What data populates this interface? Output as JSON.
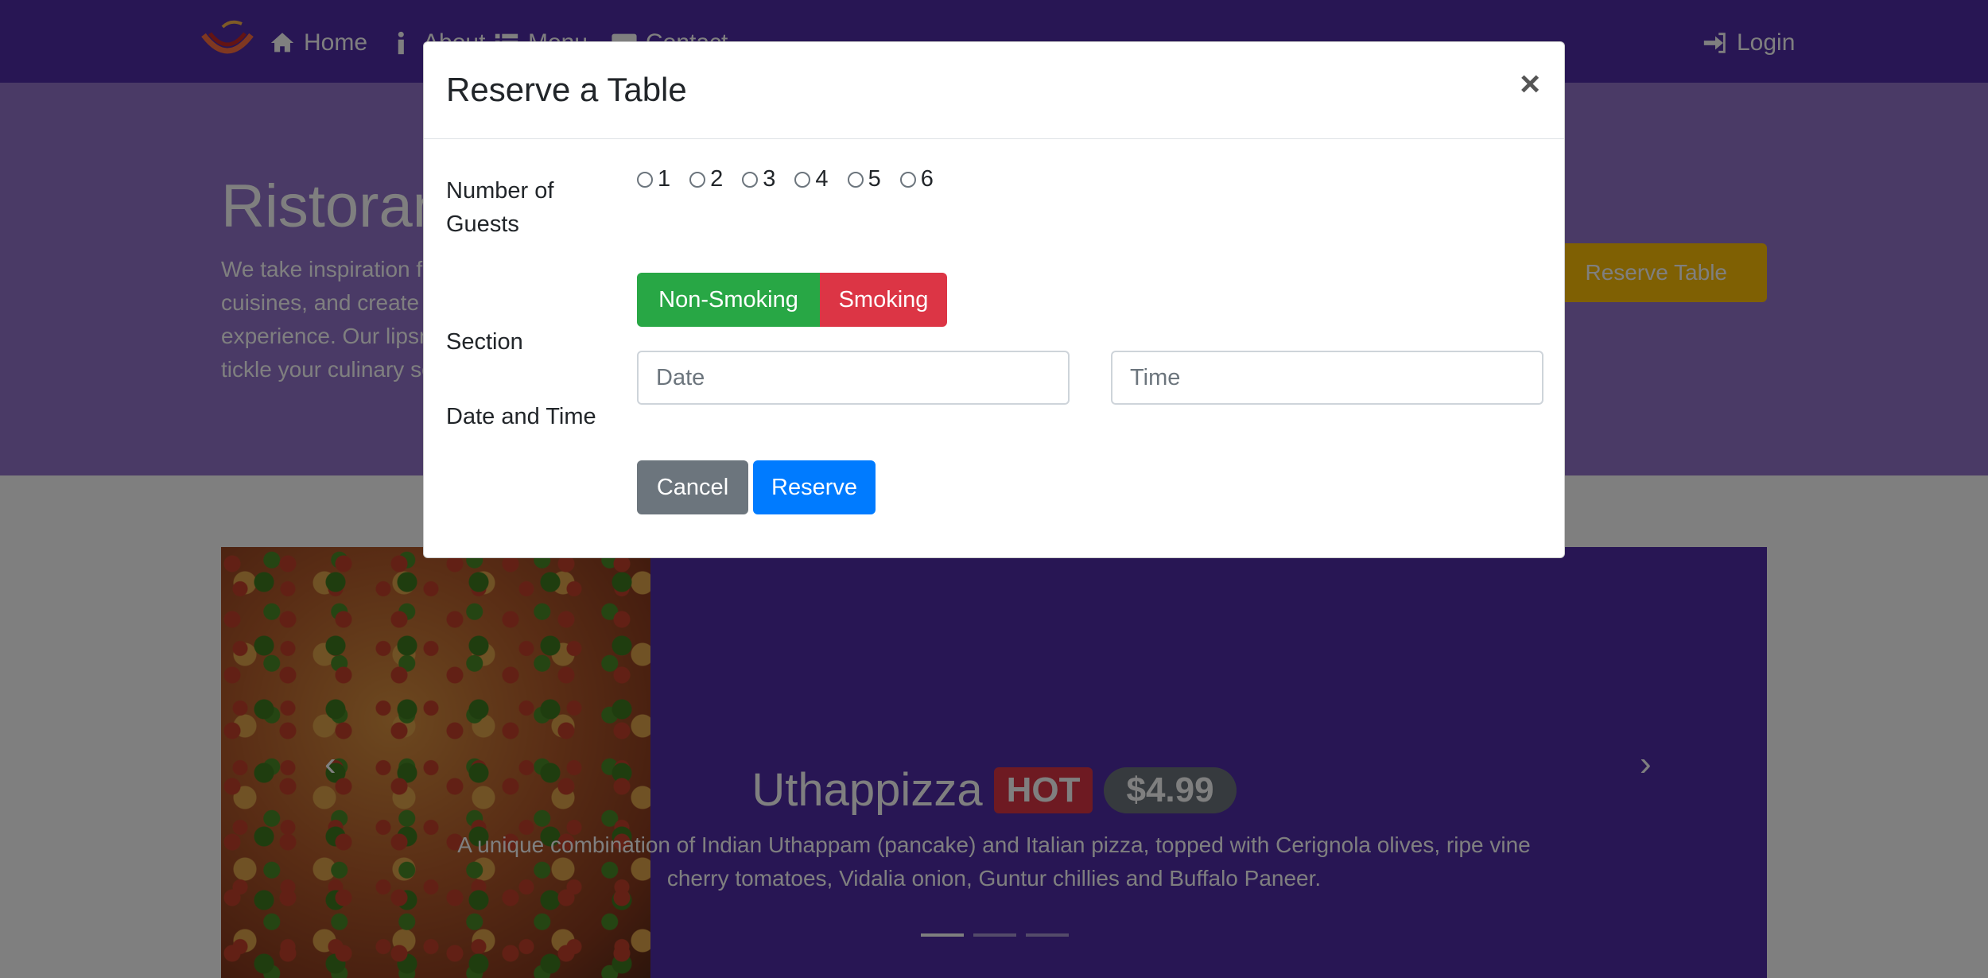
{
  "navbar": {
    "home": "Home",
    "about": "About",
    "menu": "Menu",
    "contact": "Contact",
    "login": "Login"
  },
  "jumbotron": {
    "title": "Ristorante Con Fusion",
    "text": "We take inspiration from the World's best cuisines, and create a unique fusion experience. Our lipsmacking creations will tickle your culinary senses!",
    "reserve_button": "Reserve Table"
  },
  "carousel": {
    "dish_name": "Uthappizza",
    "badge": "HOT",
    "price": "$4.99",
    "description": "A unique combination of Indian Uthappam (pancake) and Italian pizza, topped with Cerignola olives, ripe vine cherry tomatoes, Vidalia onion, Guntur chillies and Buffalo Paneer."
  },
  "modal": {
    "title": "Reserve a Table",
    "close": "×",
    "guests_label": "Number of Guests",
    "guest_options": [
      "1",
      "2",
      "3",
      "4",
      "5",
      "6"
    ],
    "section_label": "Section",
    "non_smoking": "Non-Smoking",
    "smoking": "Smoking",
    "datetime_label": "Date and Time",
    "date_placeholder": "Date",
    "time_placeholder": "Time",
    "cancel": "Cancel",
    "reserve": "Reserve"
  },
  "colors": {
    "primary": "#512da8",
    "jumbotron": "#9575cd",
    "success": "#28a745",
    "danger": "#dc3545",
    "secondary": "#6c757d",
    "blue": "#007bff",
    "warning": "#ffc107"
  }
}
